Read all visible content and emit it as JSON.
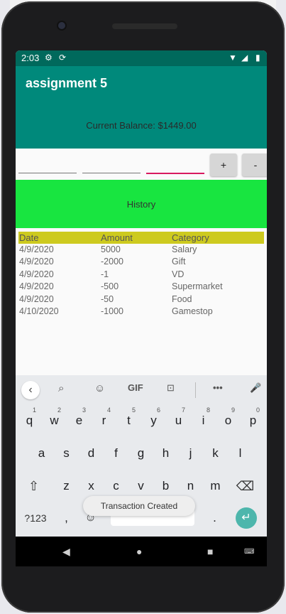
{
  "status_bar": {
    "time": "2:03",
    "icons": [
      "gear-icon",
      "sync-icon",
      "wifi-icon",
      "signal-icon",
      "battery-icon"
    ]
  },
  "app_bar": {
    "title": "assignment 5"
  },
  "balance": {
    "text": "Current Balance: $1449.00"
  },
  "inputs": {
    "field1_value": "",
    "field2_value": "",
    "field3_value": ""
  },
  "buttons": {
    "plus_label": "+",
    "minus_label": "-"
  },
  "history": {
    "label": "History"
  },
  "table": {
    "headers": [
      "Date",
      "Amount",
      "Category"
    ],
    "rows": [
      [
        "4/9/2020",
        "5000",
        "Salary"
      ],
      [
        "4/9/2020",
        "-2000",
        "Gift"
      ],
      [
        "4/9/2020",
        "-1",
        "VD"
      ],
      [
        "4/9/2020",
        "-500",
        "Supermarket"
      ],
      [
        "4/9/2020",
        "-50",
        "Food"
      ],
      [
        "4/10/2020",
        "-1000",
        "Gamestop"
      ]
    ]
  },
  "keyboard": {
    "suggestion_icons": [
      "back-icon",
      "search-icon",
      "sticker-icon",
      "gif-icon",
      "translate-icon",
      "more-icon",
      "mic-icon"
    ],
    "gif_label": "GIF",
    "row1": [
      "q",
      "w",
      "e",
      "r",
      "t",
      "y",
      "u",
      "i",
      "o",
      "p"
    ],
    "row1_numbers": [
      "1",
      "2",
      "3",
      "4",
      "5",
      "6",
      "7",
      "8",
      "9",
      "0"
    ],
    "row2": [
      "a",
      "s",
      "d",
      "f",
      "g",
      "h",
      "j",
      "k",
      "l"
    ],
    "row3": [
      "z",
      "x",
      "c",
      "v",
      "b",
      "n",
      "m"
    ],
    "symbols_label": "?123",
    "comma": ",",
    "period": "."
  },
  "toast": {
    "text": "Transaction Created"
  },
  "colors": {
    "primary_dark": "#00695c",
    "primary": "#00897b",
    "history_green": "#18e540",
    "header_yellow": "#cdca1f",
    "accent_pink": "#d81b60",
    "enter_teal": "#4db6ac"
  }
}
